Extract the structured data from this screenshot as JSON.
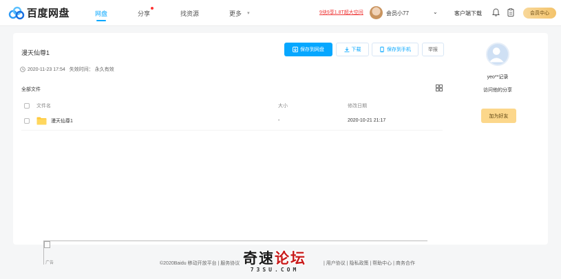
{
  "header": {
    "logo_text": "百度网盘",
    "nav": [
      {
        "label": "网盘",
        "active": true
      },
      {
        "label": "分享",
        "active": false,
        "has_dot": true
      },
      {
        "label": "找资源",
        "active": false
      },
      {
        "label": "更多",
        "active": false
      }
    ],
    "promo_link": "9块9享1.8T超大空间",
    "user_name": "会员小77",
    "client_download": "客户端下载",
    "vip_button": "会员中心"
  },
  "share": {
    "title": "漫天仙尊1",
    "time": "2020-11-23 17:54",
    "expire_label": "失效时间：",
    "expire_value": "永久有效",
    "buttons": {
      "save": "保存到网盘",
      "download": "下载",
      "save_phone": "保存到手机",
      "report": "举报"
    },
    "breadcrumb": "全部文件",
    "columns": {
      "name": "文件名",
      "size": "大小",
      "date": "修改日期"
    },
    "rows": [
      {
        "name": "漫天仙尊1",
        "size": "-",
        "date": "2020-10-21 21:17"
      }
    ]
  },
  "sidebar": {
    "name": "yeo**记录",
    "visit": "访问他的分享",
    "follow": "加为好友"
  },
  "footer": {
    "img_alt": "广告",
    "copyright": "©2020Baidu 移动开放平台 | 服务协议",
    "links": "| 用户协议 | 隐私政策 | 帮助中心 | 商务合作",
    "watermark_main_a": "奇速",
    "watermark_main_b": "论坛",
    "watermark_sub": "73SU.COM"
  },
  "colors": {
    "accent": "#06a7ff",
    "vip": "#fcd78b",
    "alert": "#ee3333"
  }
}
